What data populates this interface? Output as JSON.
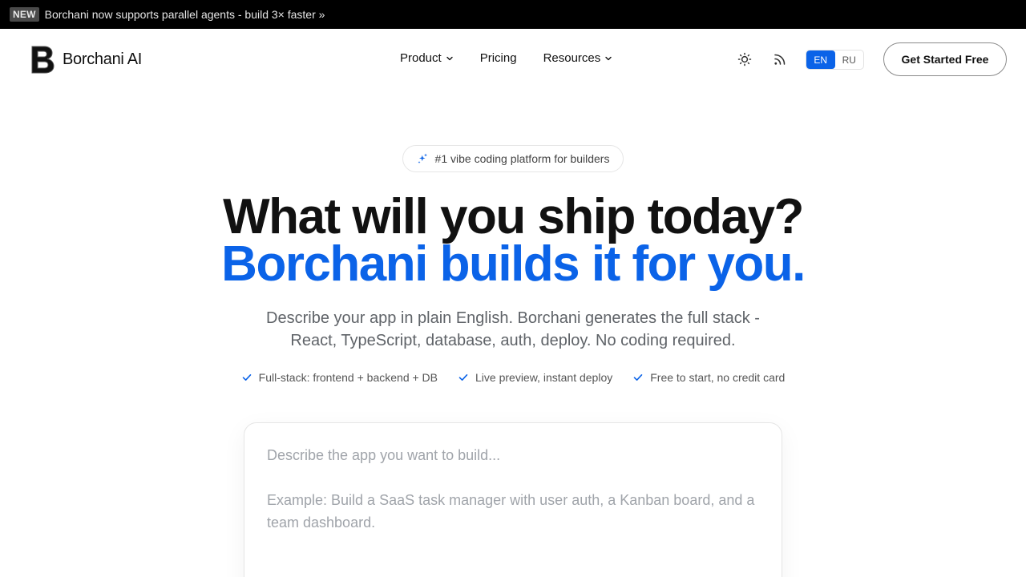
{
  "announcement": {
    "badge": "NEW",
    "message": "Borchani now supports parallel agents - build 3× faster »"
  },
  "brand": {
    "name": "Borchani AI",
    "accent_color": "#0b63e8"
  },
  "nav": {
    "items": [
      {
        "label": "Product",
        "has_dropdown": true
      },
      {
        "label": "Pricing",
        "has_dropdown": false
      },
      {
        "label": "Resources",
        "has_dropdown": true
      }
    ],
    "theme_icon": "sun-icon",
    "feed_icon": "rss-icon",
    "languages": [
      {
        "code": "EN",
        "active": true
      },
      {
        "code": "RU",
        "active": false
      }
    ],
    "cta_label": "Get Started Free"
  },
  "hero": {
    "pill_icon": "sparkle-icon",
    "pill_text": "#1 vibe coding platform for builders",
    "title_line1": "What will you ship today?",
    "title_line2": "Borchani builds it for you.",
    "subtitle_line1": "Describe your app in plain English. Borchani generates the full stack -",
    "subtitle_line2": "React, TypeScript, database, auth, deploy. No coding required.",
    "checks": [
      "Full-stack: frontend + backend + DB",
      "Live preview, instant deploy",
      "Free to start, no credit card"
    ]
  },
  "prompt": {
    "placeholder": "Describe the app you want to build...\n\nExample: Build a SaaS task manager with user auth, a Kanban board, and a team dashboard."
  }
}
